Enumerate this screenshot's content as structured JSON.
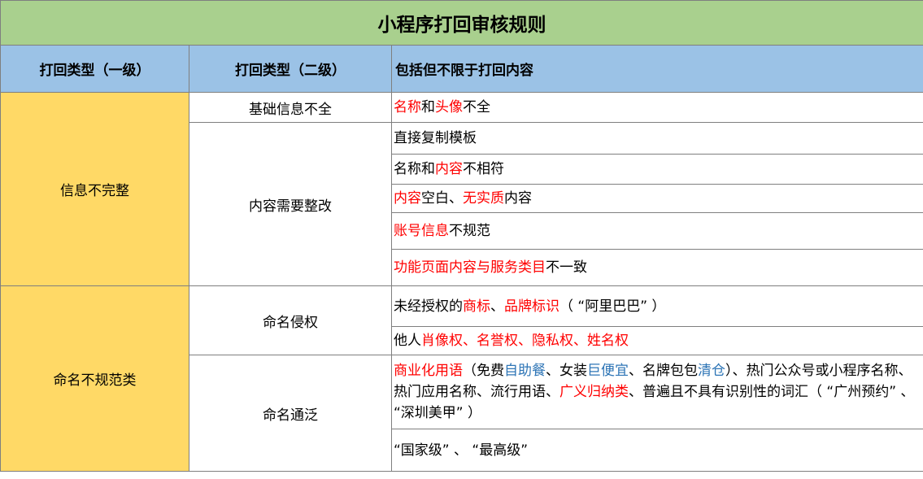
{
  "title": "小程序打回审核规则",
  "headers": {
    "col1": "打回类型（一级）",
    "col2": "打回类型（二级）",
    "col3": "包括但不限于打回内容"
  },
  "colors": {
    "title_bg": "#a9d08e",
    "header_bg": "#9bc2e6",
    "category_bg": "#ffd966",
    "highlight_red": "#ff0000",
    "highlight_blue": "#2e75b6"
  },
  "groups": [
    {
      "level1": "信息不完整",
      "subgroups": [
        {
          "level2": "基础信息不全",
          "items": [
            [
              {
                "t": "名称",
                "c": "red"
              },
              {
                "t": "和",
                "c": ""
              },
              {
                "t": "头像",
                "c": "red"
              },
              {
                "t": "不全",
                "c": ""
              }
            ]
          ]
        },
        {
          "level2": "内容需要整改",
          "items": [
            [
              {
                "t": "直接复制模板",
                "c": ""
              }
            ],
            [
              {
                "t": "名称和",
                "c": ""
              },
              {
                "t": "内容",
                "c": "red"
              },
              {
                "t": "不相符",
                "c": ""
              }
            ],
            [
              {
                "t": "内容",
                "c": "red"
              },
              {
                "t": "空白、",
                "c": ""
              },
              {
                "t": "无实质",
                "c": "red"
              },
              {
                "t": "内容",
                "c": ""
              }
            ],
            [
              {
                "t": "账号信息",
                "c": "red"
              },
              {
                "t": "不规范",
                "c": ""
              }
            ],
            [
              {
                "t": "功能页面内容与服务类目",
                "c": "red"
              },
              {
                "t": "不一致",
                "c": ""
              }
            ]
          ]
        }
      ]
    },
    {
      "level1": "命名不规范类",
      "subgroups": [
        {
          "level2": "命名侵权",
          "items": [
            [
              {
                "t": "未经授权的",
                "c": ""
              },
              {
                "t": "商标",
                "c": "red"
              },
              {
                "t": "、",
                "c": ""
              },
              {
                "t": "品牌标识",
                "c": "red"
              },
              {
                "t": "（ “阿里巴巴” ）",
                "c": ""
              }
            ],
            [
              {
                "t": "他人",
                "c": ""
              },
              {
                "t": "肖像权、名誉权、隐私权、姓名权",
                "c": "red"
              }
            ]
          ]
        },
        {
          "level2": "命名通泛",
          "items": [
            [
              {
                "t": "商业化用语",
                "c": "red"
              },
              {
                "t": "（免费",
                "c": ""
              },
              {
                "t": "自助餐",
                "c": "blue"
              },
              {
                "t": "、女装",
                "c": ""
              },
              {
                "t": "巨便宜",
                "c": "blue"
              },
              {
                "t": "、名牌包包",
                "c": ""
              },
              {
                "t": "清仓",
                "c": "blue"
              },
              {
                "t": "）、热门公众号或小程序名称、热门应用名称、流行用语、",
                "c": ""
              },
              {
                "t": "广义归纳类",
                "c": "red"
              },
              {
                "t": "、普遍且不具有识别性的词汇（ “广州预约” 、 “深圳美甲” ）",
                "c": ""
              }
            ],
            [
              {
                "t": " “国家级” 、 “最高级”",
                "c": ""
              }
            ]
          ]
        }
      ]
    }
  ]
}
